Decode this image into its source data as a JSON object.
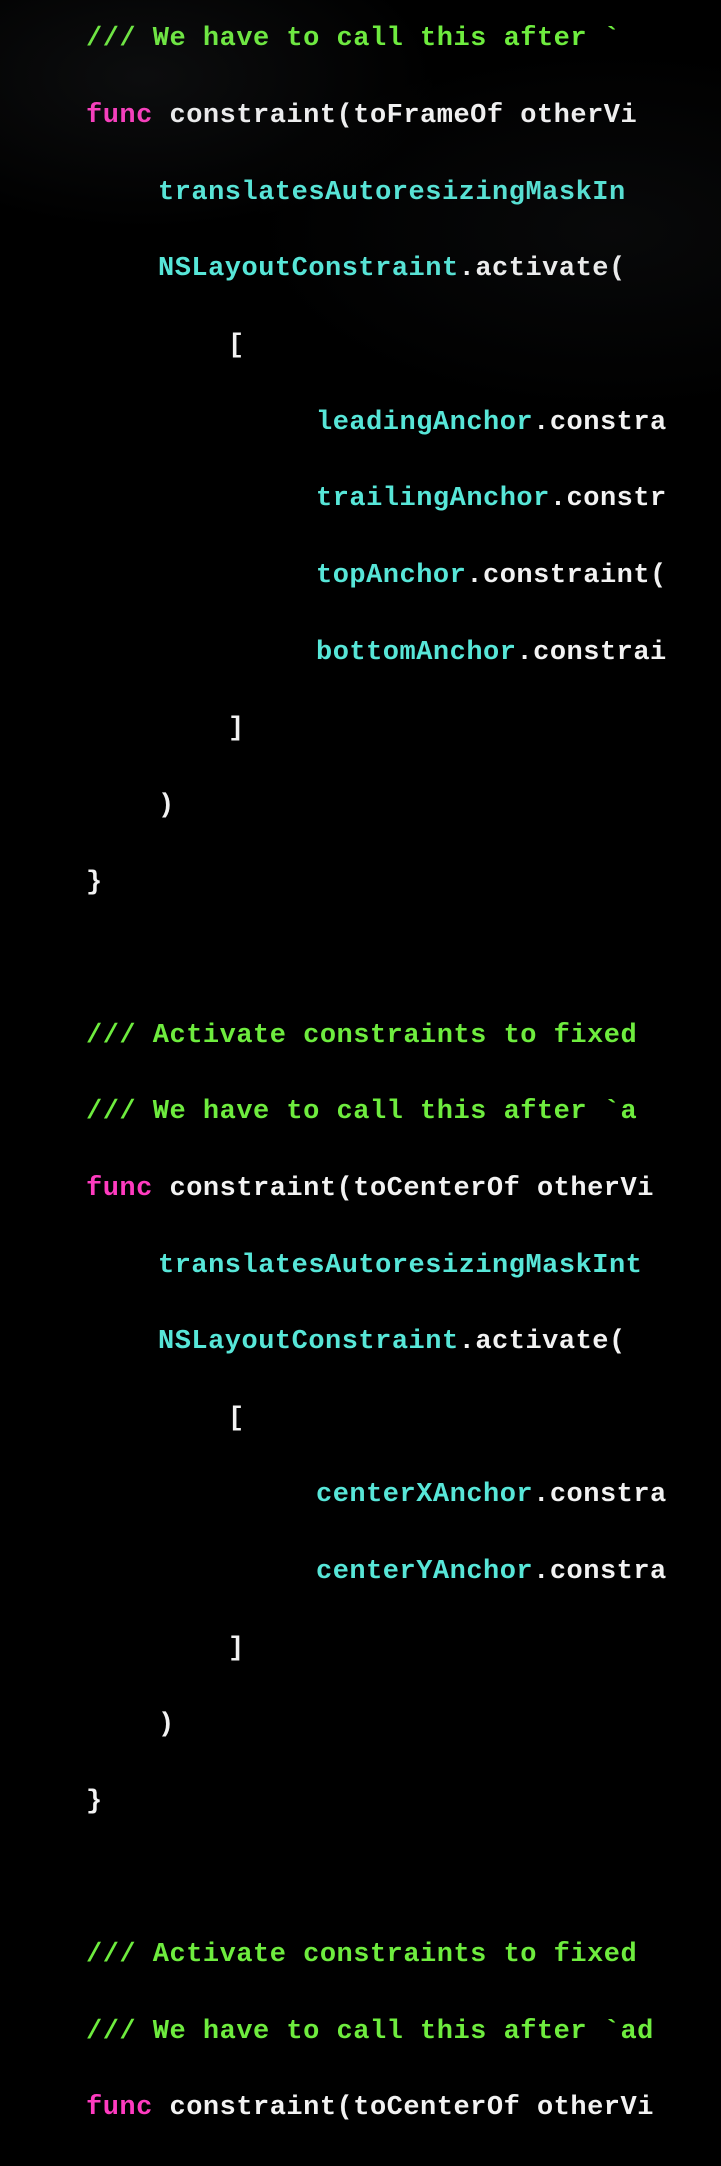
{
  "code": {
    "line1_comment": "/// We have to call this after `",
    "line2_func": "func",
    "line2_name": " constraint(toFrameOf otherVi",
    "line3": "translatesAutoresizingMaskIn",
    "line4a": "NSLayoutConstraint",
    "line4b": ".activate(",
    "line5": "[",
    "line6a": "leadingAnchor",
    "line6b": ".constra",
    "line7a": "trailingAnchor",
    "line7b": ".constr",
    "line8a": "topAnchor",
    "line8b": ".constraint(",
    "line9a": "bottomAnchor",
    "line9b": ".constrai",
    "line10": "]",
    "line11": ")",
    "line12": "}",
    "line13_comment": "/// Activate constraints to fixed",
    "line14_comment": "/// We have to call this after `a",
    "line15_func": "func",
    "line15_name_a": " constrai",
    "line15_name_b": "t(toCenterOf otherVi",
    "line16": "translatesAutoresizingMaskInt",
    "line17a": "NSLayoutConstraint",
    "line17b": ".activate(",
    "line18": "[",
    "line19a": "centerXAnchor",
    "line19b": ".constra",
    "line20a": "centerYAnchor",
    "line20b": ".constra",
    "line21": "]",
    "line22": ")",
    "line23": "}",
    "line24_comment": "/// Activate constraints to fixed ",
    "line25_comment": "/// We have to call this after `ad",
    "line26_func": "func",
    "line26_name": " constraint(toCenterOf otherVi"
  }
}
